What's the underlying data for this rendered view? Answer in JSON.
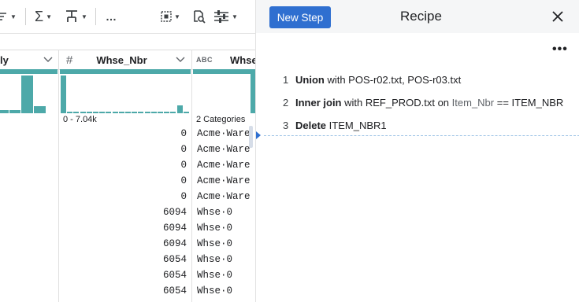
{
  "toolbar": {
    "sigma_icon": "sigma-icon",
    "more_label": "…"
  },
  "columns": [
    {
      "name_fragment": "ly",
      "type_icon": "text-type-icon"
    },
    {
      "name": "Whse_Nbr",
      "type_symbol": "#",
      "range_label": "0 - 7.04k"
    },
    {
      "name": "Whse",
      "type_badge": "ABC",
      "categories_label": "2 Categories"
    }
  ],
  "histogram": {
    "color": "#4da9a9",
    "col1_levels": [
      0.08,
      0.08,
      1.0,
      0.18
    ],
    "col2_levels": [
      1.0,
      0.04,
      0.04,
      0.04,
      0.04,
      0.04,
      0.04,
      0.04,
      0.04,
      0.04,
      0.04,
      0.04,
      0.04,
      0.04,
      0.04,
      0.04,
      0.04,
      0.04,
      0.2,
      0.04
    ]
  },
  "rows": [
    {
      "whse_nbr": "0",
      "whse": "Acme·Ware"
    },
    {
      "whse_nbr": "0",
      "whse": "Acme·Ware"
    },
    {
      "whse_nbr": "0",
      "whse": "Acme·Ware"
    },
    {
      "whse_nbr": "0",
      "whse": "Acme·Ware"
    },
    {
      "whse_nbr": "0",
      "whse": "Acme·Ware"
    },
    {
      "whse_nbr": "6094",
      "whse": "Whse·0"
    },
    {
      "whse_nbr": "6094",
      "whse": "Whse·0"
    },
    {
      "whse_nbr": "6094",
      "whse": "Whse·0"
    },
    {
      "whse_nbr": "6054",
      "whse": "Whse·0"
    },
    {
      "whse_nbr": "6054",
      "whse": "Whse·0"
    },
    {
      "whse_nbr": "6054",
      "whse": "Whse·0"
    }
  ],
  "recipe": {
    "new_step_label": "New Step",
    "title": "Recipe",
    "more_label": "•••",
    "accent": "#2f6fd0",
    "steps": [
      {
        "number": "1",
        "keyword": "Union",
        "text": " with POS-r02.txt, POS-r03.txt"
      },
      {
        "number": "2",
        "keyword": "Inner join",
        "text": " with REF_PROD.txt on ",
        "ref1": "Item_Nbr",
        "op": " == ",
        "ref2": "ITEM_NBR"
      },
      {
        "number": "3",
        "keyword": "Delete",
        "text": " ",
        "ref1": "ITEM_NBR1"
      }
    ]
  }
}
